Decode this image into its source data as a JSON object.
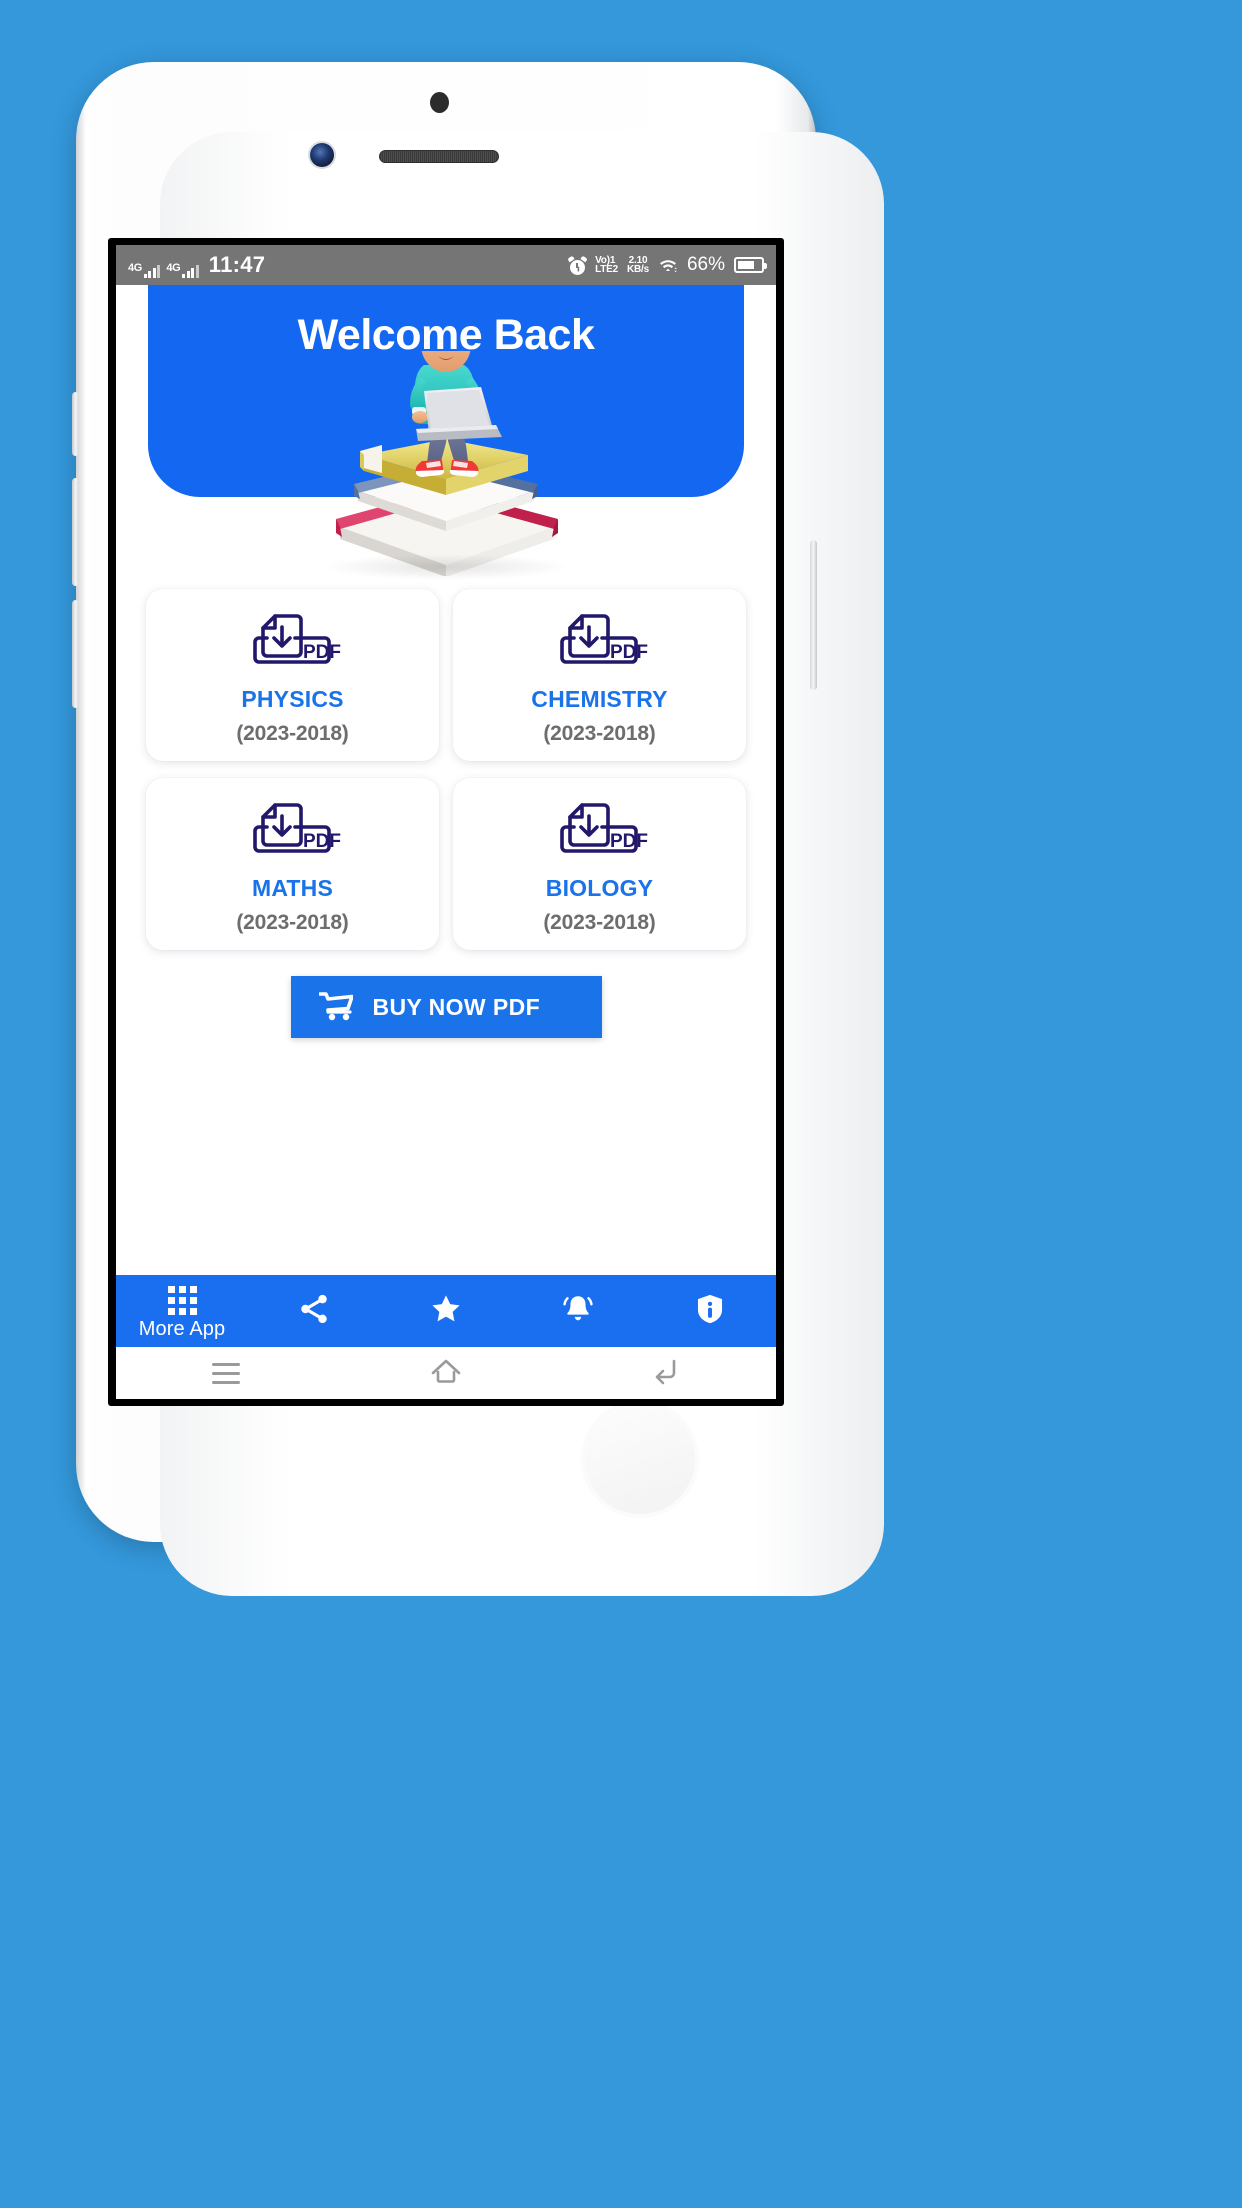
{
  "statusbar": {
    "network_1": "4G",
    "network_2": "4G",
    "time": "11:47",
    "volte_line1": "Vo)1",
    "volte_line2": "LTE2",
    "data_speed_value": "2.10",
    "data_speed_unit": "KB/s",
    "battery_percent": "66%",
    "icons": [
      "alarm-icon",
      "wifi-icon",
      "battery-icon"
    ]
  },
  "hero": {
    "title": "Welcome Back",
    "background_color": "#1367f0",
    "illustration": "boy-sitting-on-books-with-laptop-illustration"
  },
  "subjects": [
    {
      "icon": "pdf-download-icon",
      "title": "PHYSICS",
      "years": "(2023-2018)"
    },
    {
      "icon": "pdf-download-icon",
      "title": "CHEMISTRY",
      "years": "(2023-2018)"
    },
    {
      "icon": "pdf-download-icon",
      "title": "MATHS",
      "years": "(2023-2018)"
    },
    {
      "icon": "pdf-download-icon",
      "title": "BIOLOGY",
      "years": "(2023-2018)"
    }
  ],
  "icon_pdf_label": "PDF",
  "buy_button": {
    "label": "BUY NOW PDF",
    "icon": "shopping-cart-icon",
    "background_color": "#1a73e8"
  },
  "bottom_nav": {
    "background_color": "#1a6ef0",
    "items": [
      {
        "icon": "apps-grid-icon",
        "label": "More App"
      },
      {
        "icon": "share-icon",
        "label": ""
      },
      {
        "icon": "star-icon",
        "label": ""
      },
      {
        "icon": "notification-bell-icon",
        "label": ""
      },
      {
        "icon": "shield-info-icon",
        "label": ""
      }
    ]
  },
  "android_nav": {
    "items": [
      {
        "icon": "menu-recents-icon"
      },
      {
        "icon": "home-icon"
      },
      {
        "icon": "back-icon"
      }
    ]
  },
  "theme": {
    "page_background": "#3498db",
    "card_title_color": "#1a73e8",
    "card_sub_color": "#6d6d6d",
    "pdf_icon_color": "#21186b"
  }
}
